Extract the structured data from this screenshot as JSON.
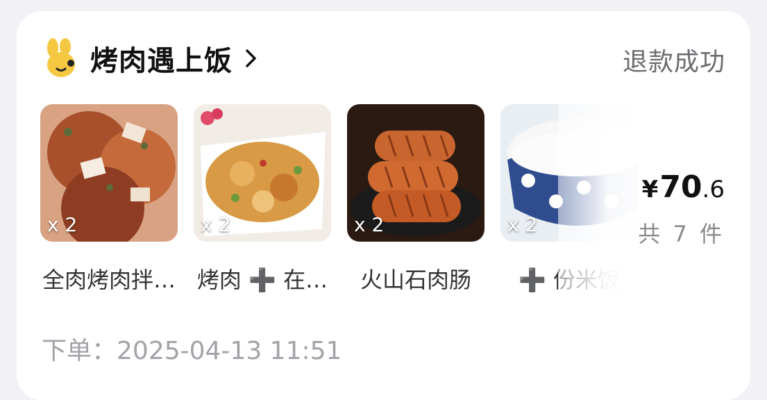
{
  "store": {
    "name": "烤肉遇上饭",
    "status": "退款成功"
  },
  "items": [
    {
      "name": "全肉烤肉拌…",
      "qty": "x 2"
    },
    {
      "name": "烤肉 ➕ 在…",
      "qty": "x 2"
    },
    {
      "name": "火山石肉肠",
      "qty": "x 2"
    },
    {
      "name": "➕ 份米饭",
      "qty": "x 2"
    }
  ],
  "summary": {
    "currency": "¥",
    "price_int": "70",
    "price_dec": ".6",
    "count": "共 7 件"
  },
  "order": {
    "label": "下单：",
    "time": "2025-04-13 11:51"
  },
  "colors": {
    "accent_logo": "#f5c842",
    "status_text": "#6b6b70",
    "meta_text": "#a2a2a8"
  },
  "icons": [
    "bunny-logo-icon",
    "chevron-right-icon"
  ]
}
